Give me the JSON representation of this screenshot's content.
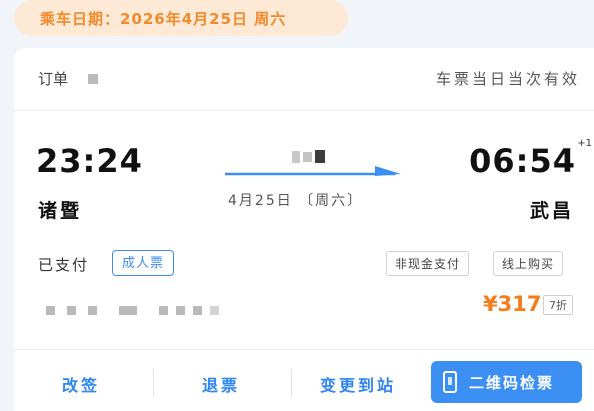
{
  "header": {
    "travel_date": "乘车日期：2026年4月25日 周六"
  },
  "order": {
    "label": "订单",
    "validity": "车票当日当次有效"
  },
  "journey": {
    "departure_time": "23:24",
    "departure_station": "诸暨",
    "arrival_time": "06:54",
    "arrival_day_offset": "+1",
    "arrival_station": "武昌",
    "date_line": "4月25日 〔周六〕"
  },
  "ticket": {
    "status": "已支付",
    "type": "成人票",
    "tags": [
      "非现金支付",
      "线上购买"
    ],
    "price": "¥317",
    "discount": "7折"
  },
  "actions": {
    "change": "改签",
    "refund": "退票",
    "change_station": "变更到站",
    "qr_checkin": "二维码检票"
  },
  "colors": {
    "accent_blue": "#3b8ef2",
    "price_orange": "#f37d1c",
    "date_pill_bg": "#fde9d6",
    "date_pill_text": "#f28a2a"
  },
  "icons": {
    "arrow": "right-arrow-icon",
    "qr": "phone-icon"
  }
}
